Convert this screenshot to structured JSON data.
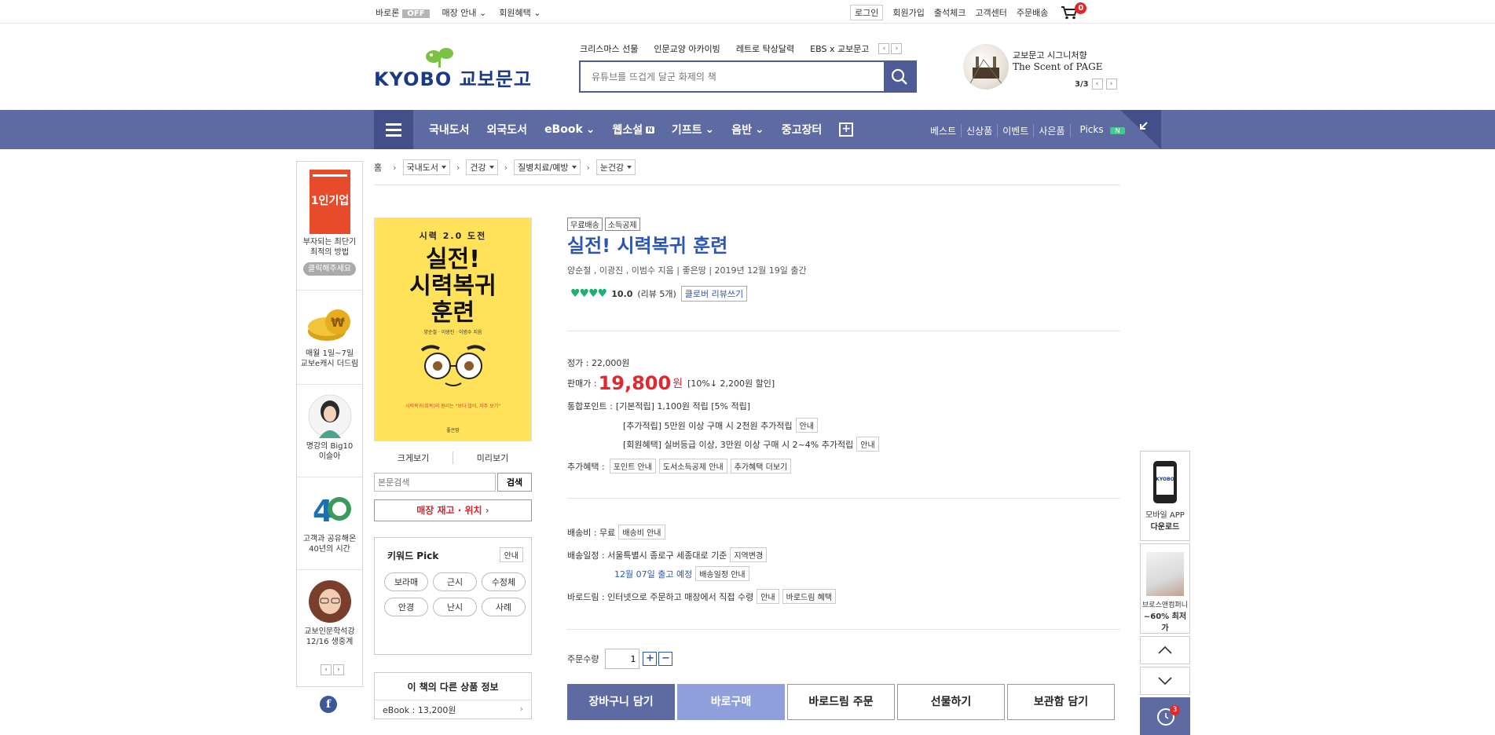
{
  "topbar": {
    "baro": "바로론",
    "baro_state": "OFF",
    "store_guide": "매장 안내",
    "benefits": "회원혜택",
    "login": "로그인",
    "join": "회원가입",
    "attendance": "출석체크",
    "customer_center": "고객센터",
    "order_delivery": "주문배송",
    "cart_count": "0"
  },
  "header": {
    "logo_text": "KYOBO 교보문고",
    "hot_links": [
      "크리스마스 선물",
      "인문교양 아카이빙",
      "레트로 탁상달력",
      "EBS x 교보문고"
    ],
    "search_placeholder": "유튜브를 뜨겁게 달군 화제의 책",
    "banner_line1": "교보문고 시그니처향",
    "banner_line2": "The Scent of PAGE",
    "banner_page": "3/3"
  },
  "nav": {
    "items": [
      "국내도서",
      "외국도서",
      "eBook",
      "웹소설",
      "기프트",
      "음반",
      "중고장터"
    ],
    "webnovel_badge": "N",
    "right": [
      "베스트",
      "신상품",
      "이벤트",
      "사은품",
      "Picks"
    ],
    "picks_badge": "N"
  },
  "left_side": {
    "items": [
      {
        "text1": "부자되는 최단기",
        "text2": "최적의 방법",
        "button": "클릭해주세요"
      },
      {
        "text1": "매월 1일~7일",
        "text2": "교보e캐시 더드림"
      },
      {
        "text1": "명강의 Big10",
        "text2": "이슬아"
      },
      {
        "text1": "고객과 공유해온",
        "text2": "40년의 시간"
      },
      {
        "text1": "교보인문학석강",
        "text2": "12/16 생중계"
      }
    ],
    "cover_mini": "1인기업"
  },
  "breadcrumb": {
    "home": "홈",
    "levels": [
      "국내도서",
      "건강",
      "질병치료/예방",
      "눈건강"
    ]
  },
  "book": {
    "cover_top": "시력 2.0 도전",
    "cover_title_1": "실전!",
    "cover_title_2": "시력복귀",
    "cover_title_3": "훈련",
    "cover_authors": "양순철 · 이광진 · 이범수 지음",
    "cover_sub": "시력복귀(회복)의 원리는 \"보다 많이, 자주 보기\"",
    "cover_pub": "좋은땅",
    "zoom": "크게보기",
    "preview": "미리보기",
    "body_search_placeholder": "본문검색",
    "body_search_button": "검색",
    "store_stock": "매장 재고 · 위치",
    "keyword_title": "키워드 Pick",
    "keyword_guide": "안내",
    "keywords": [
      "보라매",
      "근시",
      "수정체",
      "안경",
      "난시",
      "사례"
    ],
    "other_title": "이 책의 다른 상품 정보",
    "other_ebook": "eBook : 13,200원"
  },
  "product": {
    "tags": [
      "무료배송",
      "소득공제"
    ],
    "title": "실전! 시력복귀 훈련",
    "authors": "양순철 , 이광진 , 이범수 지음  |  좋은땅  |  2019년 12월 19일 출간",
    "hearts": "♥♥♥♥",
    "score": "10.0",
    "reviews": "(리뷰 5개)",
    "review_button": "클로버 리뷰쓰기",
    "list_price": "정가 : 22,000원",
    "sale_label": "판매가 :",
    "sale_price": "19,800",
    "won": "원",
    "discount": "[10%↓ 2,200원 할인]",
    "points_label": "통합포인트 :",
    "points_basic": "[기본적립] 1,100원 적립 [5% 적립]",
    "points_extra": "[추가적립] 5만원 이상 구매 시 2천원 추가적립",
    "points_member": "[회원혜택] 실버등급 이상, 3만원 이상 구매 시 2~4% 추가적립",
    "guide": "안내",
    "extra_label": "추가혜택 :",
    "extra_buttons": [
      "포인트 안내",
      "도서소득공제 안내",
      "추가혜택 더보기"
    ],
    "shipping_fee": "배송비 : 무료",
    "shipping_fee_btn": "배송비 안내",
    "schedule_label": "배송일정 : 서울특별시 종로구 세종대로 기준",
    "region_btn": "지역변경",
    "schedule_date": "12월 07일 출고 예정",
    "schedule_btn": "배송일정 안내",
    "barodrim": "바로드림 : 인터넷으로 주문하고 매장에서 직접 수령",
    "barodrim_btn": "바로드림 혜택",
    "qty_label": "주문수량",
    "qty_value": "1",
    "actions": [
      "장바구니 담기",
      "바로구매",
      "바로드림 주문",
      "선물하기",
      "보관함 담기"
    ]
  },
  "quick": {
    "app_label1": "모바일 APP",
    "app_label2": "다운로드",
    "app_phone_text": "KYOBO",
    "ad_label1": "브로스앤컴퍼니",
    "ad_label2": "~60% 최저가",
    "recent_count": "3"
  },
  "colors": {
    "accent": "#5e6aa2",
    "price_red": "#e0282e",
    "title_blue": "#2d56b0",
    "heart_green": "#1fae73"
  }
}
